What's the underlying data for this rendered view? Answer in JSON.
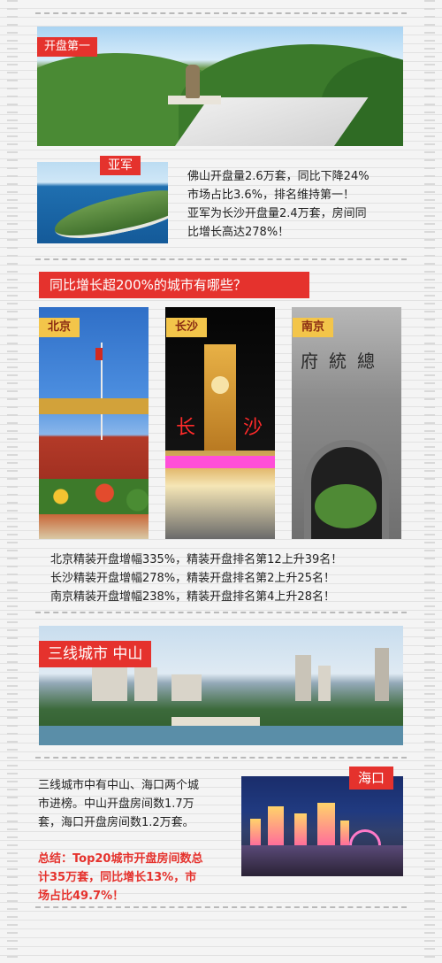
{
  "section1": {
    "tag": "开盘第一",
    "yajun_tag": "亚军",
    "lines": [
      "佛山开盘量2.6万套，同比下降24%",
      "市场占比3.6%，排名维持第一！",
      "亚军为长沙开盘量2.4万套，房间同",
      "比增长高达278%！"
    ]
  },
  "section2": {
    "banner": "同比增长超200%的城市有哪些？",
    "cities": [
      {
        "name": "北京"
      },
      {
        "name": "长沙"
      },
      {
        "name": "南京"
      }
    ],
    "lines": [
      "北京精装开盘增幅335%，精装开盘排名第12上升39名！",
      "长沙精装开盘增幅278%，精装开盘排名第2上升25名！",
      "南京精装开盘增幅238%，精装开盘排名第4上升28名！"
    ]
  },
  "section3": {
    "tag": "三线城市 中山",
    "haikou_tag": "海口",
    "lines": [
      "三线城市中有中山、海口两个城",
      "市进榜。中山开盘房间数1.7万",
      "套，海口开盘房间数1.2万套。"
    ],
    "summary": [
      "总结：Top20城市开盘房间数总",
      "计35万套，同比增长13%，市",
      "场占比49.7%！"
    ]
  },
  "colors": {
    "accent_red": "#e5322d",
    "city_tag_yellow": "#f3c54a"
  }
}
